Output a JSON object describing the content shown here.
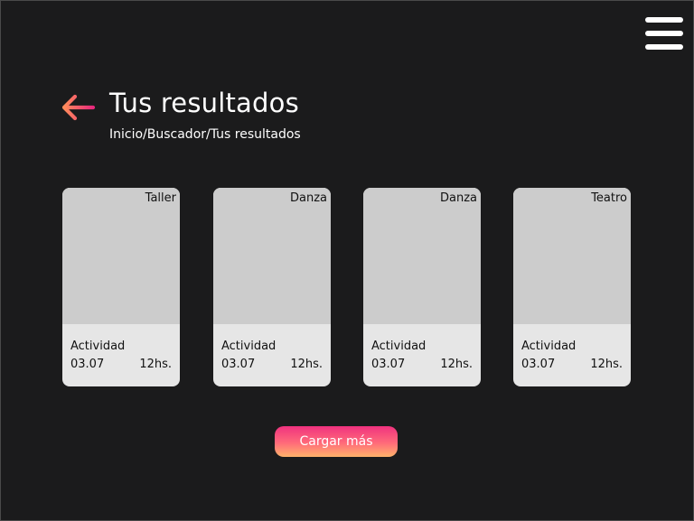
{
  "header": {
    "title": "Tus resultados",
    "breadcrumb": "Inicio/Buscador/Tus resultados"
  },
  "icons": {
    "menu": "hamburger-menu-icon",
    "back": "arrow-left-icon"
  },
  "colors": {
    "background": "#1b1b1c",
    "card_image": "#cccccc",
    "card_body": "#e6e6e6",
    "accent_gradient": [
      "#f0327f",
      "#ffb36b"
    ],
    "back_arrow_gradient": [
      "#ff8c5a",
      "#e8287d"
    ]
  },
  "cards": [
    {
      "category": "Taller",
      "activity": "Actividad",
      "date": "03.07",
      "time": "12hs."
    },
    {
      "category": "Danza",
      "activity": "Actividad",
      "date": "03.07",
      "time": "12hs."
    },
    {
      "category": "Danza",
      "activity": "Actividad",
      "date": "03.07",
      "time": "12hs."
    },
    {
      "category": "Teatro",
      "activity": "Actividad",
      "date": "03.07",
      "time": "12hs."
    }
  ],
  "actions": {
    "load_more_label": "Cargar más"
  }
}
